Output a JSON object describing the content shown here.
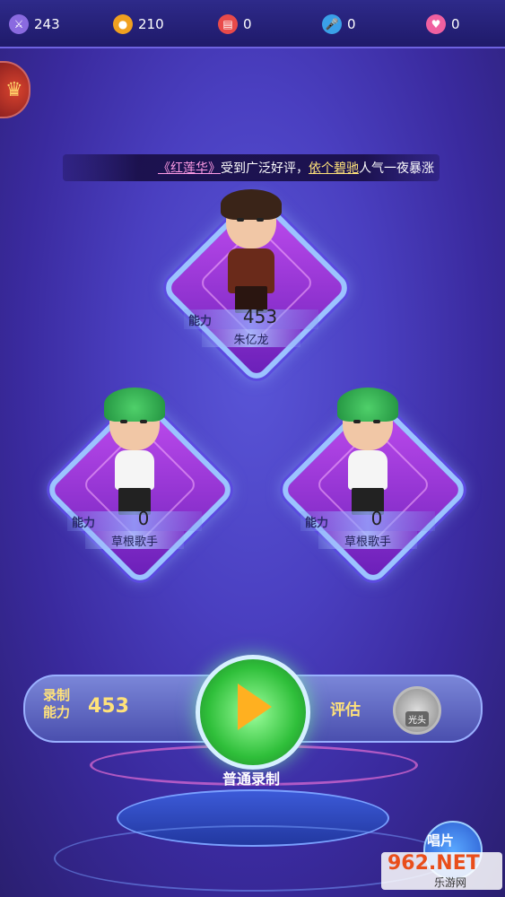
{
  "topbar": {
    "stats": [
      {
        "icon": "sword-icon",
        "value": "243",
        "color": "#8a6ae0"
      },
      {
        "icon": "coin-icon",
        "value": "210",
        "color": "#f0a020"
      },
      {
        "icon": "ticket-icon",
        "value": "0",
        "color": "#e94a4a"
      },
      {
        "icon": "microphone-icon",
        "value": "0",
        "color": "#3aa0e8"
      },
      {
        "icon": "heart-icon",
        "value": "0",
        "color": "#f060a0"
      }
    ]
  },
  "ticker": {
    "prefix_open": "《",
    "song": "红莲华",
    "prefix_close": "》",
    "text1": "受到广泛好评，",
    "name": "依个碧驰",
    "text2": "人气一夜暴涨"
  },
  "cards": [
    {
      "ability_label": "能力",
      "ability": "453",
      "name": "朱亿龙",
      "hair": "dark"
    },
    {
      "ability_label": "能力",
      "ability": "0",
      "name": "草根歌手",
      "hair": "green"
    },
    {
      "ability_label": "能力",
      "ability": "0",
      "name": "草根歌手",
      "hair": "green"
    }
  ],
  "record_bar": {
    "label": "录制能力",
    "value": "453",
    "eval_label": "评估",
    "medal_text": "光头"
  },
  "record_button": {
    "label": "普通录制"
  },
  "disc_button": {
    "label": "唱片"
  },
  "watermark": {
    "big": "962.NET",
    "small": "乐游网"
  }
}
